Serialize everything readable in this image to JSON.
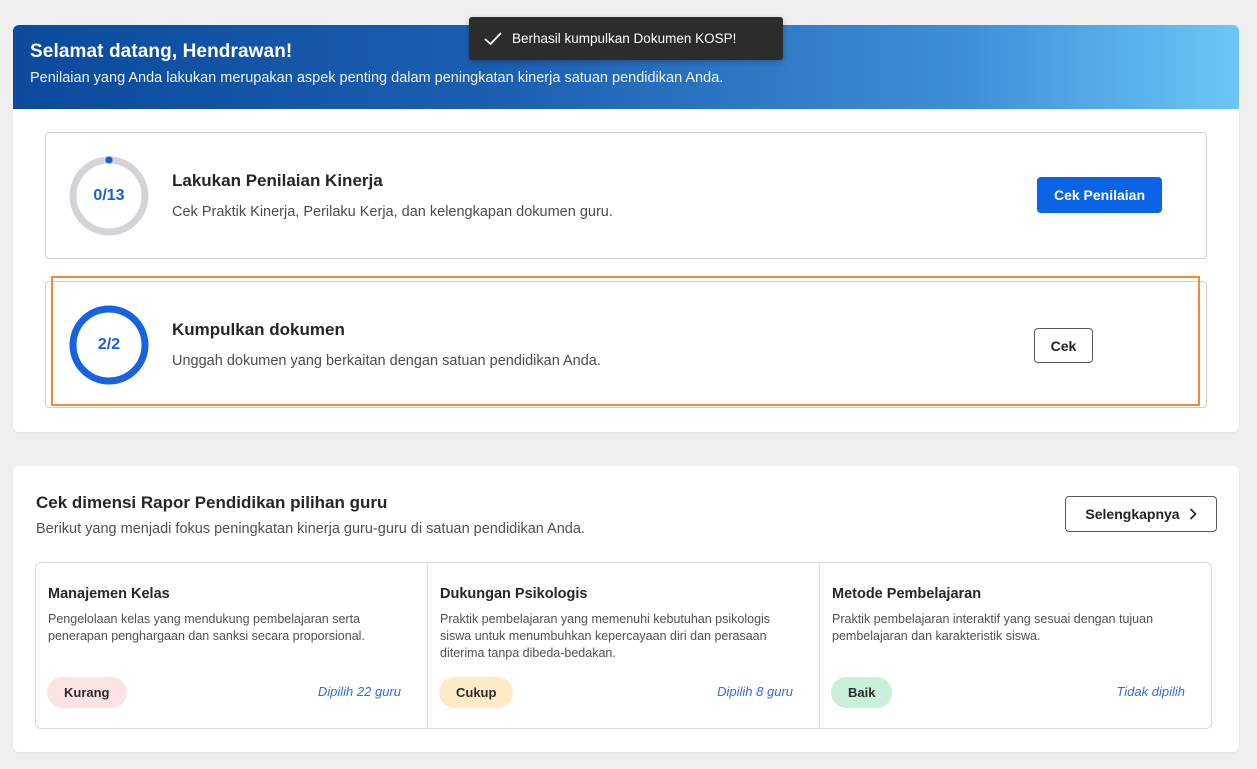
{
  "banner": {
    "title": "Selamat datang, Hendrawan!",
    "subtitle": "Penilaian yang Anda lakukan merupakan aspek penting dalam peningkatan kinerja satuan pendidikan Anda."
  },
  "toast": {
    "message": "Berhasil kumpulkan Dokumen KOSP!"
  },
  "tasks": [
    {
      "progress_label": "0/13",
      "progress_fraction": 0.0,
      "title": "Lakukan Penilaian Kinerja",
      "description": "Cek Praktik Kinerja, Perilaku Kerja, dan kelengkapan dokumen guru.",
      "button_label": "Cek Penilaian"
    },
    {
      "progress_label": "2/2",
      "progress_fraction": 1.0,
      "title": "Kumpulkan dokumen",
      "description": "Unggah dokumen yang berkaitan dengan satuan pendidikan Anda.",
      "button_label": "Cek"
    }
  ],
  "dimensions_section": {
    "title": "Cek dimensi Rapor Pendidikan pilihan guru",
    "subtitle": "Berikut yang menjadi fokus peningkatan kinerja guru-guru di satuan pendidikan Anda.",
    "more_button_label": "Selengkapnya",
    "items": [
      {
        "title": "Manajemen Kelas",
        "description": "Pengelolaan kelas yang mendukung pembelajaran serta penerapan penghargaan dan sanksi secara proporsional.",
        "status": "Kurang",
        "chosen": "Dipilih 22 guru"
      },
      {
        "title": "Dukungan Psikologis",
        "description": "Praktik pembelajaran yang memenuhi kebutuhan psikologis siswa untuk menumbuhkan kepercayaan diri dan perasaan diterima tanpa dibeda-bedakan.",
        "status": "Cukup",
        "chosen": "Dipilih 8 guru"
      },
      {
        "title": "Metode Pembelajaran",
        "description": "Praktik pembelajaran interaktif yang sesuai dengan tujuan pembelajaran dan karakteristik siswa.",
        "status": "Baik",
        "chosen": "Tidak dipilih"
      }
    ]
  },
  "colors": {
    "primary": "#0b63e5",
    "highlight": "#f08b3a",
    "status_kurang": "#fde3e4",
    "status_cukup": "#fdebc8",
    "status_baik": "#c9f0d8",
    "link": "#2f6fd6"
  },
  "icons": {
    "toast": "check-icon",
    "more_button": "chevron-right-icon"
  }
}
